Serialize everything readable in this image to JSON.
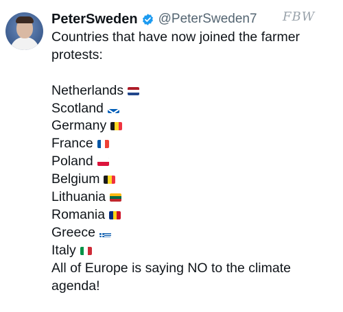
{
  "tweet": {
    "display_name": "PeterSweden",
    "handle": "@PeterSweden7",
    "verified_icon": "verified-badge-icon",
    "watermark": "FBW",
    "intro": "Countries that have now joined the farmer protests:",
    "countries": [
      {
        "name": "Netherlands",
        "flag": "netherlands-flag-icon",
        "colors": [
          "#ae1c28",
          "#ffffff",
          "#21468b"
        ],
        "orientation": "horizontal"
      },
      {
        "name": "Scotland",
        "flag": "scotland-flag-icon",
        "colors": [
          "#005eb8",
          "#ffffff"
        ],
        "orientation": "saltire"
      },
      {
        "name": "Germany",
        "flag": "belgium-flag-icon",
        "colors": [
          "#1a1a1a",
          "#fdda24",
          "#ef3340"
        ],
        "orientation": "vertical"
      },
      {
        "name": "France",
        "flag": "france-flag-icon",
        "colors": [
          "#0055a4",
          "#ffffff",
          "#ef4135"
        ],
        "orientation": "vertical"
      },
      {
        "name": "Poland",
        "flag": "poland-flag-icon",
        "colors": [
          "#ffffff",
          "#dc143c"
        ],
        "orientation": "horizontal"
      },
      {
        "name": "Belgium",
        "flag": "belgium-flag-icon",
        "colors": [
          "#1a1a1a",
          "#fdda24",
          "#ef3340"
        ],
        "orientation": "vertical"
      },
      {
        "name": "Lithuania",
        "flag": "lithuania-flag-icon",
        "colors": [
          "#fdb913",
          "#006a44",
          "#c1272d"
        ],
        "orientation": "horizontal"
      },
      {
        "name": "Romania",
        "flag": "romania-flag-icon",
        "colors": [
          "#002b7f",
          "#fcd116",
          "#ce1126"
        ],
        "orientation": "vertical"
      },
      {
        "name": "Greece",
        "flag": "greece-flag-icon",
        "colors": [
          "#0d5eaf",
          "#ffffff"
        ],
        "orientation": "stripes"
      },
      {
        "name": "Italy",
        "flag": "italy-flag-icon",
        "colors": [
          "#009246",
          "#ffffff",
          "#ce2b37"
        ],
        "orientation": "vertical"
      }
    ],
    "closing": "All of Europe is saying NO to the climate agenda!"
  },
  "colors": {
    "verified": "#1d9bf0",
    "text": "#0f1419",
    "handle": "#536471"
  }
}
